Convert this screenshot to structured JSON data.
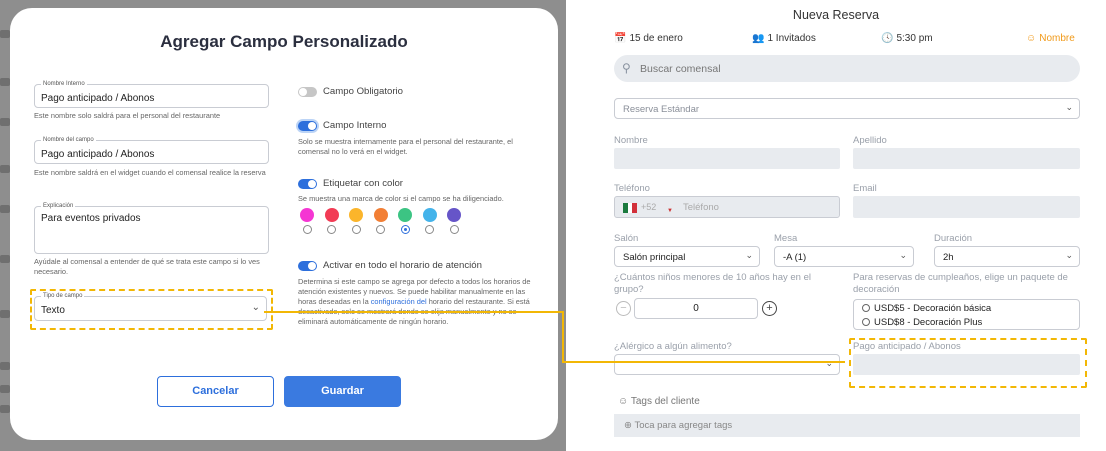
{
  "modal": {
    "title": "Agregar Campo Personalizado",
    "nombre_interno": {
      "label": "Nombre Interno",
      "value": "Pago anticipado / Abonos",
      "help": "Este nombre solo saldrá para el personal del restaurante"
    },
    "nombre_campo": {
      "label": "Nombre del campo",
      "value": "Pago anticipado / Abonos",
      "help": "Este nombre saldrá en el widget cuando el comensal realice la reserva"
    },
    "explicacion": {
      "label": "Explicación",
      "value": "Para eventos privados",
      "help": "Ayúdale al comensal a entender de qué se trata este campo si lo ves necesario."
    },
    "tipo_campo": {
      "label": "Tipo de campo",
      "value": "Texto"
    },
    "toggles": {
      "obligatorio": {
        "label": "Campo Obligatorio",
        "on": false
      },
      "interno": {
        "label": "Campo Interno",
        "on": true,
        "help": "Solo se muestra internamente para el personal del restaurante, el comensal no lo verá en el widget."
      },
      "color": {
        "label": "Etiquetar con color",
        "on": true,
        "help": "Se muestra una marca de color si el campo se ha diligenciado."
      },
      "horario": {
        "label": "Activar en todo el horario de atención",
        "on": true,
        "help_a": "Determina si este campo se agrega por defecto a todos los horarios de atención existentes y nuevos. Se puede habilitar manualmente en las horas deseadas en la ",
        "help_link": "configuración del",
        "help_b": "horario del restaurante. Si está desactivado, solo se mostrará donde se elija manualmente y no se eliminará automáticamente de ningún horario."
      }
    },
    "colors": [
      "#f536d3",
      "#f23b55",
      "#fbb52b",
      "#f27f35",
      "#3cc483",
      "#44b3ea",
      "#6655c8"
    ],
    "selected_color_index": 4,
    "buttons": {
      "cancel": "Cancelar",
      "save": "Guardar"
    }
  },
  "reserva": {
    "title": "Nueva Reserva",
    "date": "15 de enero",
    "guests": "1 Invitados",
    "time": "5:30 pm",
    "name": "Nombre",
    "search_placeholder": "Buscar comensal",
    "tipo": "Reserva Estándar",
    "labels": {
      "nombre": "Nombre",
      "apellido": "Apellido",
      "telefono": "Teléfono",
      "email": "Email",
      "salon": "Salón",
      "mesa": "Mesa",
      "duracion": "Duración",
      "ninos": "¿Cuántos niños menores de 10 años hay en el grupo?",
      "cumple": "Para reservas de cumpleaños, elige un paquete de decoración",
      "alergico": "¿Alérgico a algún alimento?",
      "pago": "Pago anticipado / Abonos",
      "tags": "Tags del cliente"
    },
    "phone_code": "+52",
    "phone_placeholder": "Teléfono",
    "salon_value": "Salón principal",
    "mesa_value": "-A (1)",
    "duracion_value": "2h",
    "ninos_value": "0",
    "decoracion": [
      "USD$5 - Decoración básica",
      "USD$8 - Decoración Plus"
    ],
    "tags_placeholder": "Toca para agregar tags"
  },
  "colors": {
    "accent": "#2d6fdc",
    "highlight": "#f2b705",
    "name_orange": "#f19a1a"
  }
}
